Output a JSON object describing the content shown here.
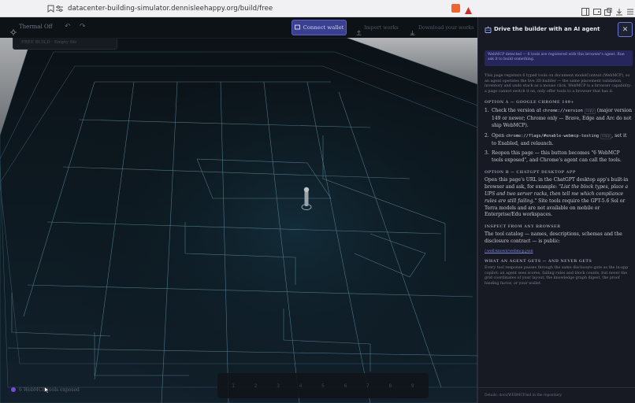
{
  "browser": {
    "url": "datacenter-building-simulator.dennisleehappy.org/build/free"
  },
  "topbar": {
    "app_name": "Thermal Off",
    "connect_label": "Connect wallet",
    "import_label": "Import works",
    "download_label": "Download your works"
  },
  "ghost_card": {
    "text": "FREE BUILD · Empty file"
  },
  "palette": {
    "slots": [
      "1",
      "2",
      "3",
      "4",
      "5",
      "6",
      "7",
      "8",
      "9"
    ]
  },
  "status": {
    "text": "6 WebMCP tools exposed"
  },
  "panel": {
    "title": "Drive the builder with an AI agent",
    "close_label": "✕",
    "notice": "WebMCP detected — 6 tools are registered with this browser's agent. Run ask it to build something.",
    "intro": "This page registers 6 typed tools on document.modelContext (WebMCP), so an agent operates the live 3D builder — the same placement validation, inventory and undo stack as a mouse click. WebMCP is a browser capability: a page cannot switch it on, only offer tools to a browser that has it.",
    "option_a_heading": "OPTION A — GOOGLE CHROME 149+",
    "option_a_steps": [
      {
        "n": "1.",
        "pre": "Check the version at ",
        "code": "chrome://version",
        "copy": "copy",
        "post": " (major version 149 or newer; Chrome only — Brave, Edge and Arc do not ship WebMCP)."
      },
      {
        "n": "2.",
        "pre": "Open ",
        "code": "chrome://flags/#enable-webmcp-testing",
        "copy": "copy",
        "post": ", set it to Enabled, and relaunch."
      },
      {
        "n": "3.",
        "pre": "Reopen this page — this button becomes \"6 WebMCP tools exposed\", and Chrome's agent can call the tools.",
        "code": "",
        "copy": "",
        "post": ""
      }
    ],
    "option_b_heading": "OPTION B — CHATGPT DESKTOP APP",
    "option_b_text_1": "Open this page's URL in the ChatGPT desktop app's built-in browser and ask, for example: ",
    "option_b_quote": "\"List the block types, place a UPS and two server racks, then tell me which compliance rules are still failing.\"",
    "option_b_text_2": " Site tools require the GPT-5.6 Sol or Terra models and are not available on mobile or Enterprise/Edu workspaces.",
    "inspect_heading": "INSPECT FROM ANY BROWSER",
    "inspect_text": "The tool catalog — names, descriptions, schemas and the disclosure contract — is public:",
    "inspect_link": "/.well-known/webmcp.json",
    "gets_heading": "WHAT AN AGENT GETS — AND NEVER GETS",
    "gets_text": "Every tool response passes through the same disclosure gate as the in-app copilot: an agent sees scores, failing rules and block counts, but never the grid coordinates of your layout, the knowledge graph digest, the proof binding factor, or your wallet.",
    "footer": "Details: docs/WEBMCP.md in the repository."
  },
  "colors": {
    "accent": "#3a3f8f",
    "panel_bg": "#171a22",
    "scene_line": "#4a6a7a"
  }
}
